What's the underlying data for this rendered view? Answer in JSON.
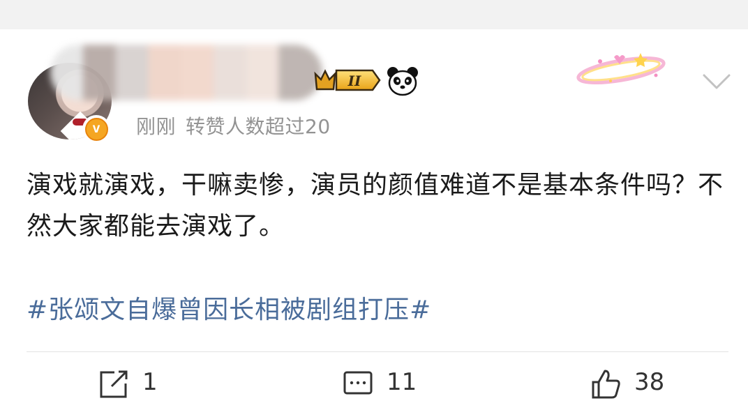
{
  "post": {
    "meta": {
      "time": "刚刚",
      "reposts_note": "转赞人数超过20"
    },
    "text": "演戏就演戏，干嘛卖惨，演员的颜值难道不是基本条件吗？不然大家都能去演戏了。",
    "hashtag": "#张颂文自爆曾因长相被剧组打压#",
    "level_badge": "II"
  },
  "actions": {
    "forward_count": "1",
    "comment_count": "11",
    "like_count": "38"
  },
  "colors": {
    "hashtag": "#4a6c9a",
    "verified_badge": "#f5a623",
    "meta_text": "#939393"
  },
  "icons": [
    "v-badge-icon",
    "crown-level-icon",
    "panda-icon",
    "chevron-down-icon",
    "forward-icon",
    "comment-icon",
    "like-icon"
  ]
}
